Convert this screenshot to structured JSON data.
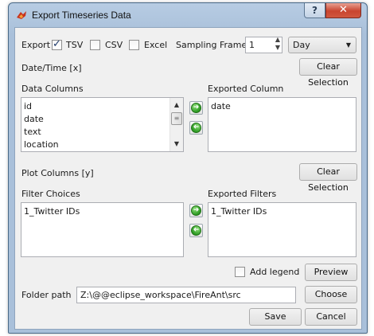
{
  "window": {
    "title": "Export Timeseries Data",
    "help_label": "?",
    "close_label": "✕",
    "icon": "fire-ant-icon"
  },
  "export_row": {
    "export_label": "Export",
    "tsv": {
      "label": "TSV",
      "checked": true
    },
    "csv": {
      "label": "CSV",
      "checked": false
    },
    "excel": {
      "label": "Excel",
      "checked": false
    },
    "sampling_label": "Sampling Frame",
    "sampling_value": "1",
    "unit_value": "Day"
  },
  "datetime": {
    "label": "Date/Time [x]",
    "clear_label": "Clear Selection"
  },
  "data_columns": {
    "label": "Data Columns",
    "items": [
      "id",
      "date",
      "text",
      "location"
    ]
  },
  "exported_column": {
    "label": "Exported Column",
    "items": [
      "date"
    ]
  },
  "plot": {
    "label": "Plot Columns [y]",
    "clear_label": "Clear Selection"
  },
  "filter_choices": {
    "label": "Filter Choices",
    "items": [
      "1_Twitter IDs"
    ]
  },
  "exported_filters": {
    "label": "Exported Filters",
    "items": [
      "1_Twitter IDs"
    ]
  },
  "legend": {
    "label": "Add legend",
    "checked": false,
    "preview_label": "Preview"
  },
  "folder": {
    "label": "Folder path",
    "value": "Z:\\@@eclipse_workspace\\FireAnt\\src",
    "choose_label": "Choose"
  },
  "footer": {
    "save_label": "Save",
    "cancel_label": "Cancel"
  },
  "colors": {
    "titlebar": "#b7cce3",
    "close_button": "#c9452f",
    "move_arrow": "#2c9a22",
    "dialog_bg": "#f0f0f0"
  }
}
